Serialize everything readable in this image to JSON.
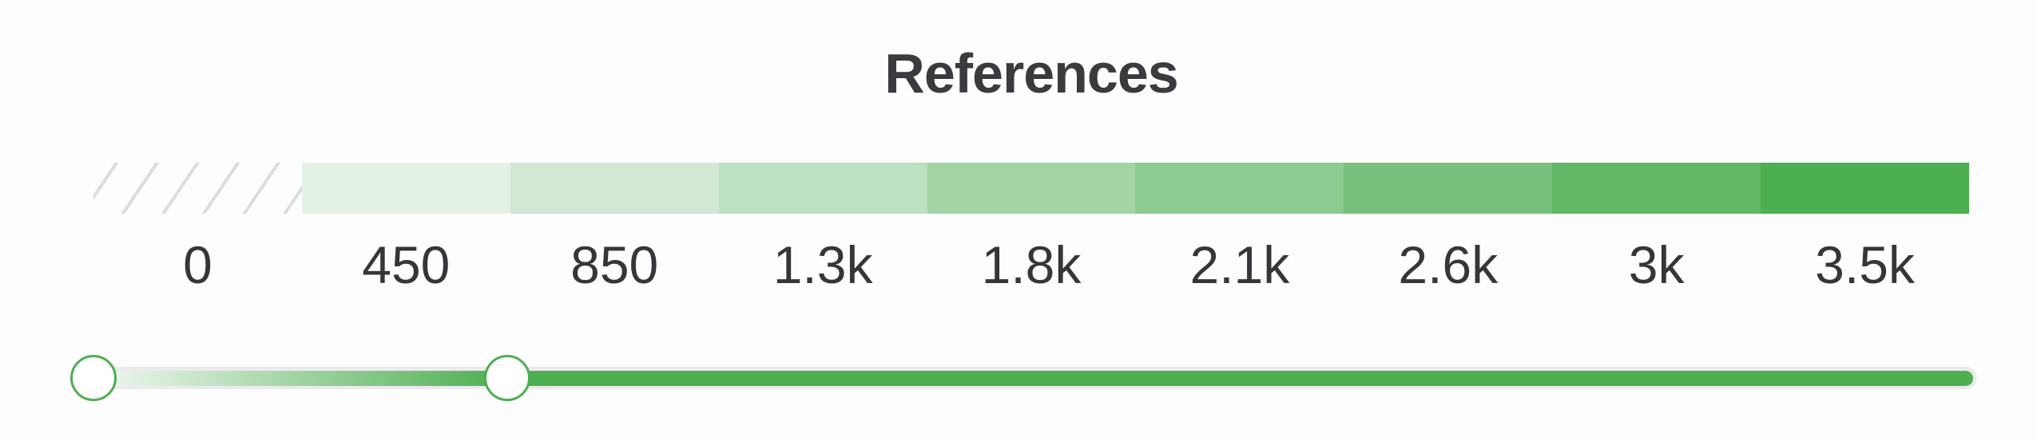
{
  "chart_data": {
    "type": "heatmap",
    "title": "References",
    "legend_kind": "color-scale",
    "buckets": [
      {
        "label": "0",
        "color": "hatched",
        "no_data": true
      },
      {
        "label": "450",
        "color": "#e4f2e6"
      },
      {
        "label": "850",
        "color": "#d0e8d4"
      },
      {
        "label": "1.3k",
        "color": "#bce0c0"
      },
      {
        "label": "1.8k",
        "color": "#a2d4a5"
      },
      {
        "label": "2.1k",
        "color": "#8dcb90"
      },
      {
        "label": "2.6k",
        "color": "#78c17c"
      },
      {
        "label": "3k",
        "color": "#62b867"
      },
      {
        "label": "3.5k",
        "color": "#4caf50"
      }
    ],
    "hatch_color": "#dcdcde",
    "xlim_labels": [
      "0",
      "3.5k"
    ]
  },
  "range_slider": {
    "accent_color": "#4caf50",
    "track_color": "#ebebed",
    "handles": [
      {
        "name": "min-handle",
        "position_fraction": 0.0
      },
      {
        "name": "threshold-handle",
        "position_fraction": 0.22
      }
    ],
    "fill_end_fraction": 1.0
  }
}
